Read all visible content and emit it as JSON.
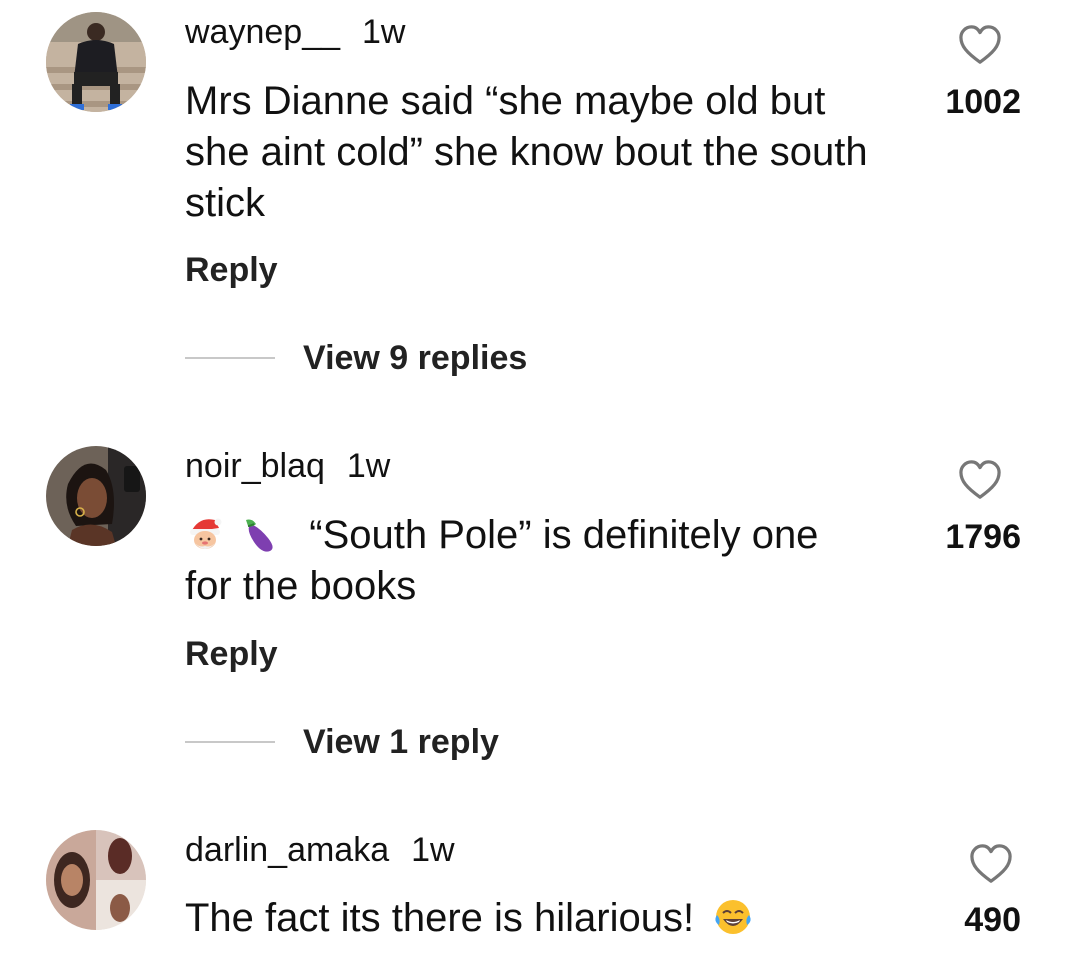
{
  "comments": [
    {
      "username": "waynep__",
      "time": "1w",
      "text": "Mrs Dianne said “she maybe old but she aint cold” she know bout the south stick",
      "likes": "1002",
      "reply_label": "Reply",
      "view_replies_label": "View 9 replies"
    },
    {
      "username": "noir_blaq",
      "time": "1w",
      "emoji_prefix": [
        "santa-emoji",
        "eggplant-emoji"
      ],
      "text": "“South Pole” is definitely one for the books",
      "likes": "1796",
      "reply_label": "Reply",
      "view_replies_label": "View 1 reply"
    },
    {
      "username": "darlin_amaka",
      "time": "1w",
      "text": "The fact its there is hilarious!",
      "emoji_suffix": [
        "tears-of-joy-emoji"
      ],
      "likes": "490"
    }
  ],
  "icons": {
    "like": "heart-outline-icon"
  }
}
